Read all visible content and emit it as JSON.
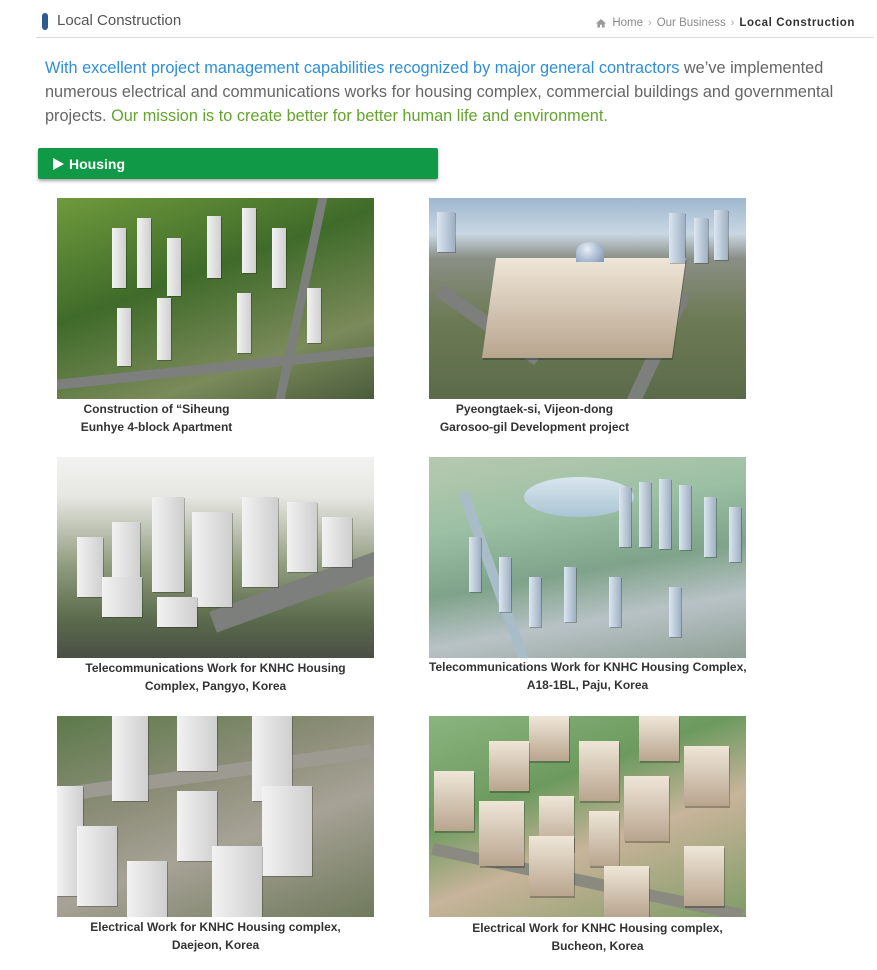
{
  "header": {
    "title": "Local Construction",
    "breadcrumb": {
      "home": "Home",
      "section": "Our Business",
      "current": "Local Construction"
    }
  },
  "intro": {
    "highlight_blue": "With excellent project management capabilities recognized by major general contractors",
    "body": " we’ve implemented numerous electrical and communications works for housing complex, commercial buildings and governmental projects. ",
    "highlight_green": "Our mission is to create better for better human life and environment."
  },
  "section": {
    "label": "Housing",
    "icon": "play-icon",
    "accent_color": "#109a47"
  },
  "projects": [
    {
      "line1": "Construction of “Siheung",
      "line2": "Eunhye 4-block Apartment"
    },
    {
      "line1": "Pyeongtaek-si, Vijeon-dong",
      "line2": "Garosoo-gil Development project"
    },
    {
      "line1": "Telecommunications Work for KNHC Housing",
      "line2": "Complex, Pangyo, Korea"
    },
    {
      "line1": "Telecommunications Work for KNHC Housing Complex,",
      "line2": "A18-1BL,  Paju, Korea"
    },
    {
      "line1": "Electrical Work for KNHC Housing complex,",
      "line2": "Daejeon, Korea"
    },
    {
      "line1": "Electrical Work for KNHC Housing complex,",
      "line2": "Bucheon, Korea"
    }
  ],
  "colors": {
    "intro_blue": "#2e8fd6",
    "intro_green": "#64a42e",
    "title_marker": "#2f5c8f"
  }
}
